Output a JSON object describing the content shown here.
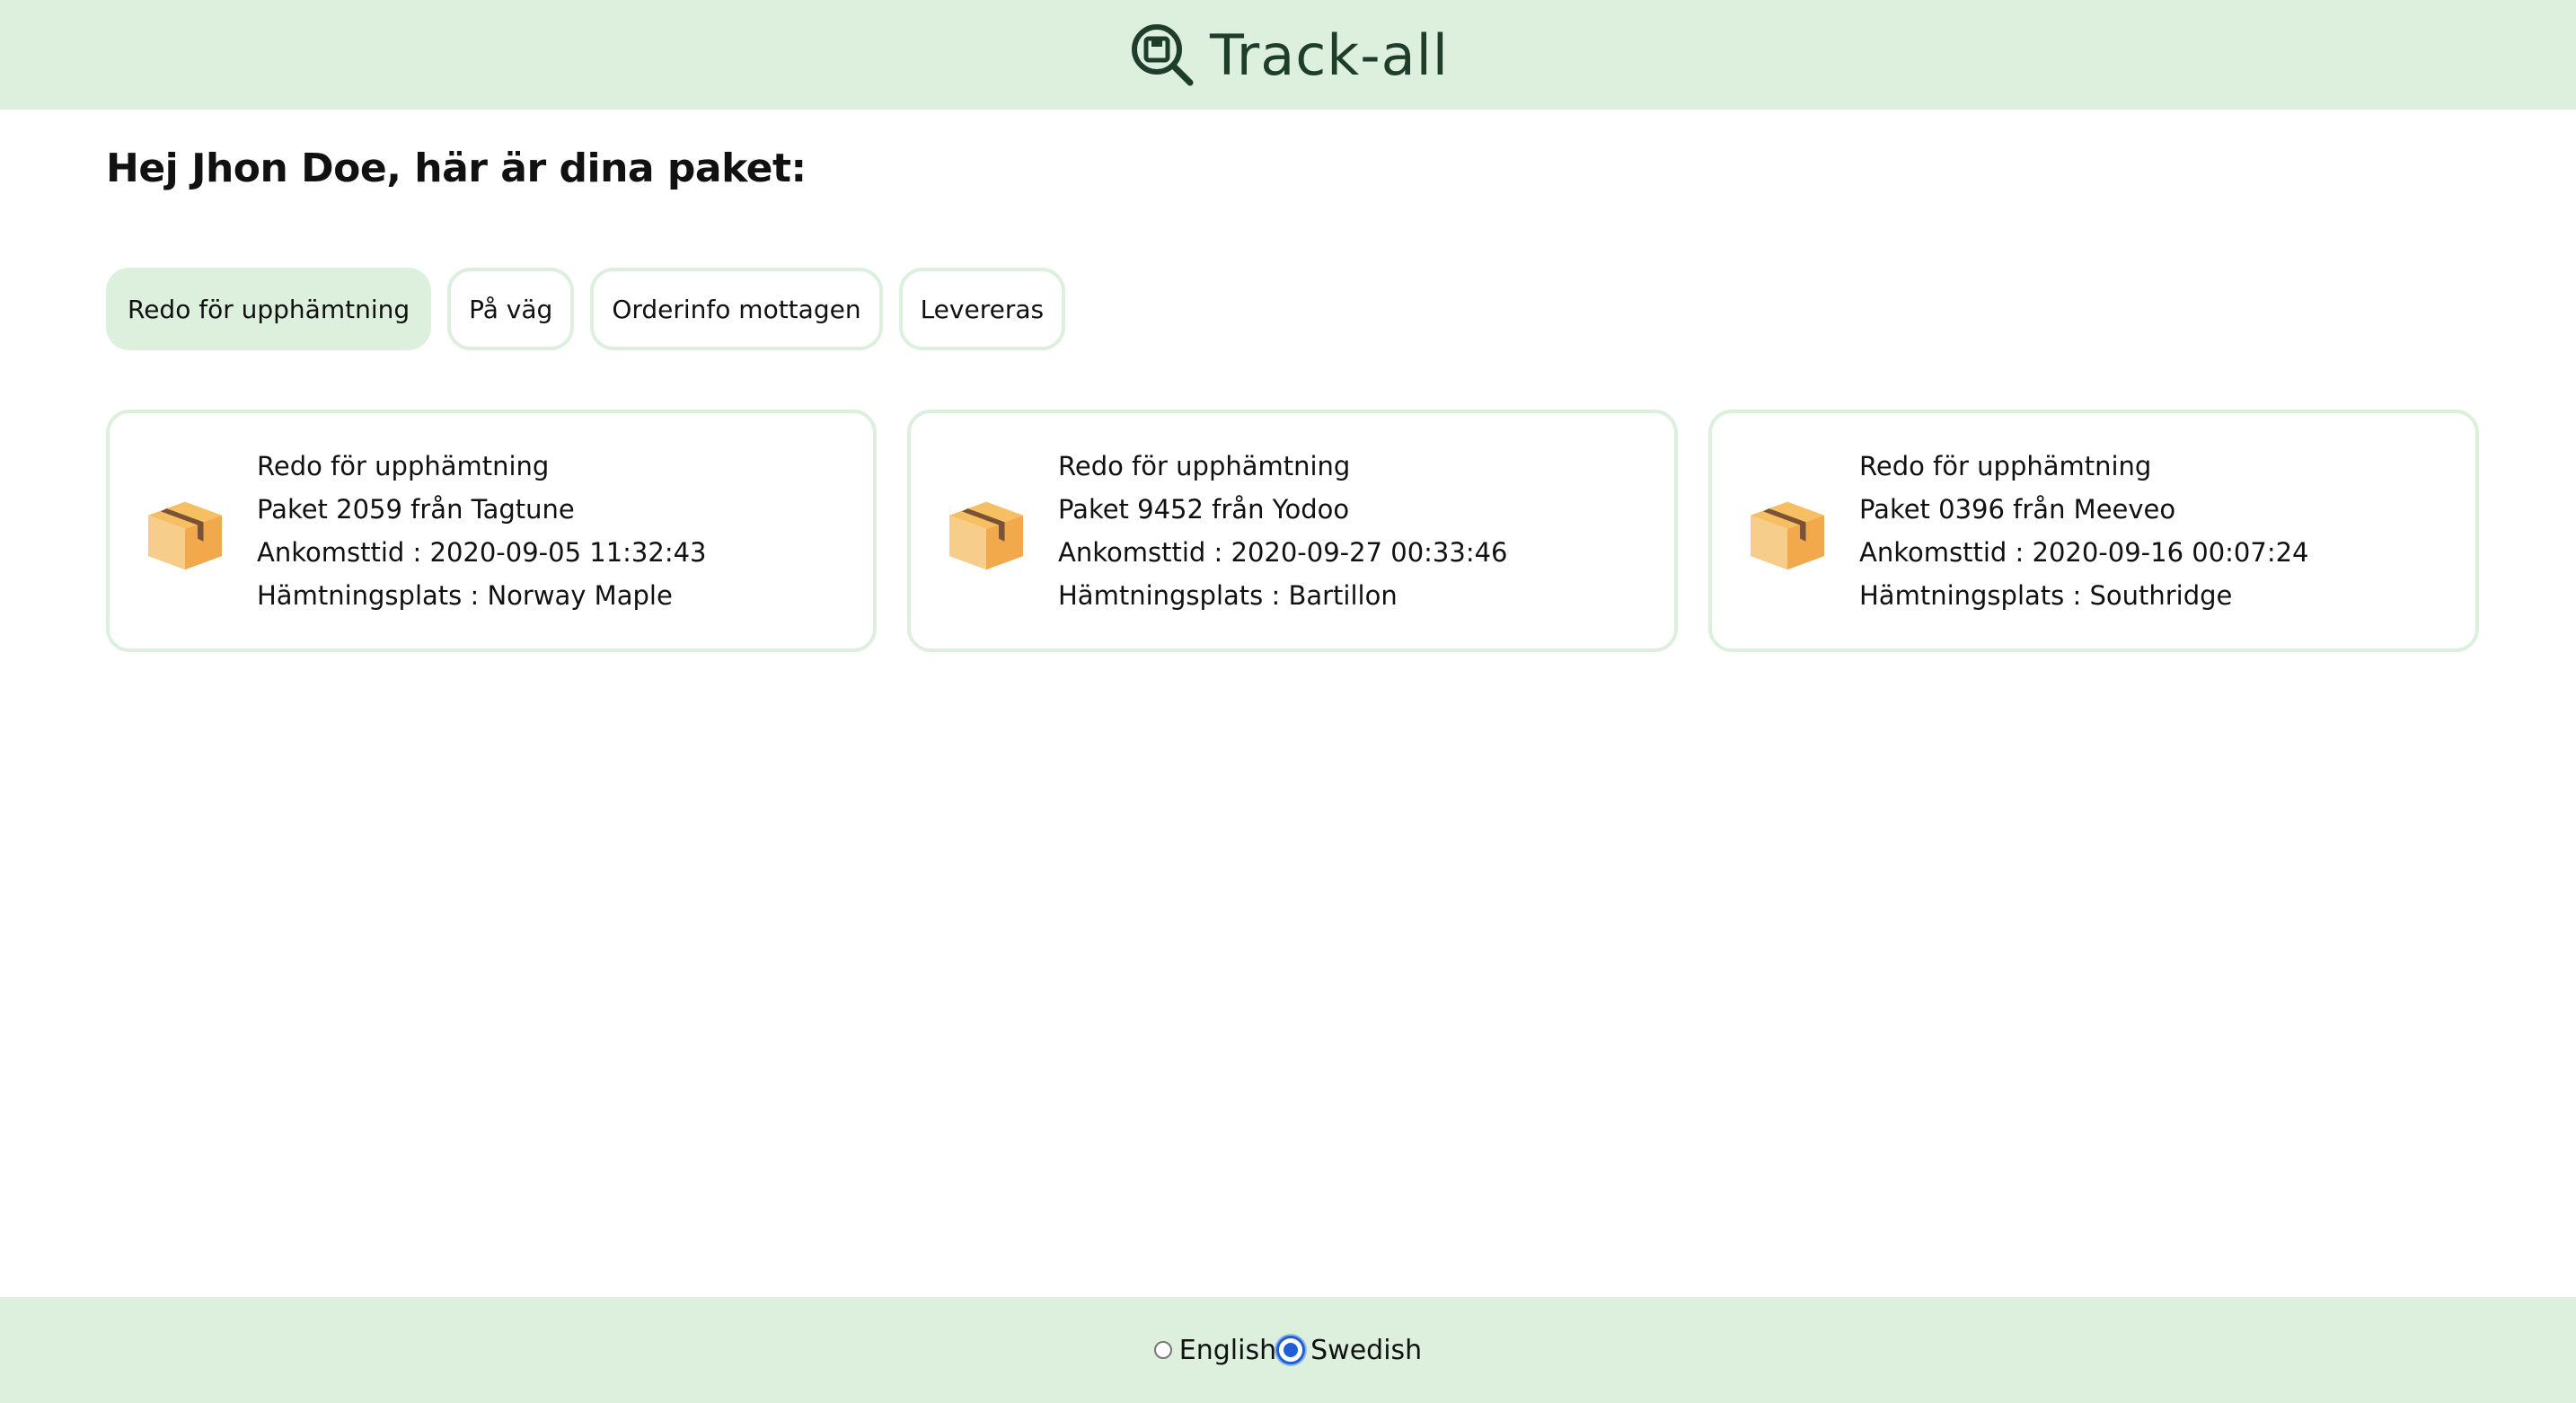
{
  "header": {
    "title": "Track-all",
    "logo_icon": "package-search-icon"
  },
  "greeting": "Hej Jhon Doe, här är dina paket:",
  "tabs": [
    {
      "label": "Redo för upphämtning",
      "active": true
    },
    {
      "label": "På väg",
      "active": false
    },
    {
      "label": "Orderinfo mottagen",
      "active": false
    },
    {
      "label": "Levereras",
      "active": false
    }
  ],
  "packages": [
    {
      "status": "Redo för upphämtning",
      "title": "Paket 2059 från Tagtune",
      "arrival": "Ankomsttid : 2020-09-05 11:32:43",
      "pickup": "Hämtningsplats : Norway Maple",
      "icon": "package-box-icon"
    },
    {
      "status": "Redo för upphämtning",
      "title": "Paket 9452 från Yodoo",
      "arrival": "Ankomsttid : 2020-09-27 00:33:46",
      "pickup": "Hämtningsplats : Bartillon",
      "icon": "package-box-icon"
    },
    {
      "status": "Redo för upphämtning",
      "title": "Paket 0396 från Meeveo",
      "arrival": "Ankomsttid : 2020-09-16 00:07:24",
      "pickup": "Hämtningsplats : Southridge",
      "icon": "package-box-icon"
    }
  ],
  "footer": {
    "languages": [
      {
        "label": "English",
        "selected": false
      },
      {
        "label": "Swedish",
        "selected": true
      }
    ]
  },
  "colors": {
    "header_bg": "#ddf0dd",
    "brand_text": "#1f3d2b",
    "radio_accent": "#1e5fd6",
    "box_orange": "#f2a94b"
  }
}
